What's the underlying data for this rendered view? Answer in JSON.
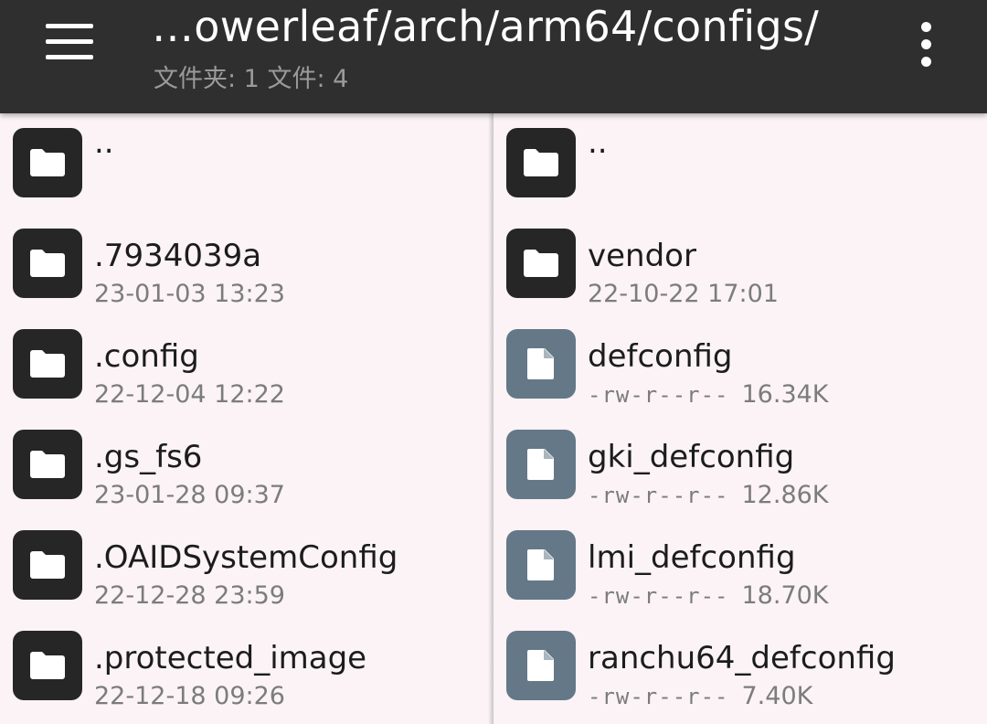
{
  "appbar": {
    "title": "…owerleaf/arch/arm64/configs/",
    "subtitle": "文件夹: 1  文件: 4",
    "menu_icon": "hamburger-menu-icon",
    "overflow_icon": "more-vertical-icon",
    "background_color": "#2f2f2f"
  },
  "left_pane": {
    "items": [
      {
        "name": "..",
        "type": "folder",
        "date": ""
      },
      {
        "name": ".7934039a",
        "type": "folder",
        "date": "23-01-03 13:23"
      },
      {
        "name": ".config",
        "type": "folder",
        "date": "22-12-04 12:22"
      },
      {
        "name": ".gs_fs6",
        "type": "folder",
        "date": "23-01-28 09:37"
      },
      {
        "name": ".OAIDSystemConfig",
        "type": "folder",
        "date": "22-12-28 23:59"
      },
      {
        "name": ".protected_image",
        "type": "folder",
        "date": "22-12-18 09:26"
      }
    ]
  },
  "right_pane": {
    "items": [
      {
        "name": "..",
        "type": "folder",
        "date": ""
      },
      {
        "name": "vendor",
        "type": "folder",
        "date": "22-10-22 17:01"
      },
      {
        "name": "defconfig",
        "type": "file",
        "perm": "-rw-r--r--",
        "size": "16.34K"
      },
      {
        "name": "gki_defconfig",
        "type": "file",
        "perm": "-rw-r--r--",
        "size": "12.86K"
      },
      {
        "name": "lmi_defconfig",
        "type": "file",
        "perm": "-rw-r--r--",
        "size": "18.70K"
      },
      {
        "name": "ranchu64_defconfig",
        "type": "file",
        "perm": "-rw-r--r--",
        "size": "7.40K"
      }
    ]
  },
  "colors": {
    "folder_icon_bg": "#262626",
    "file_icon_bg": "#647887",
    "list_background": "#fbf3f6"
  },
  "icons": {
    "folder": "folder-icon",
    "file": "file-icon"
  }
}
